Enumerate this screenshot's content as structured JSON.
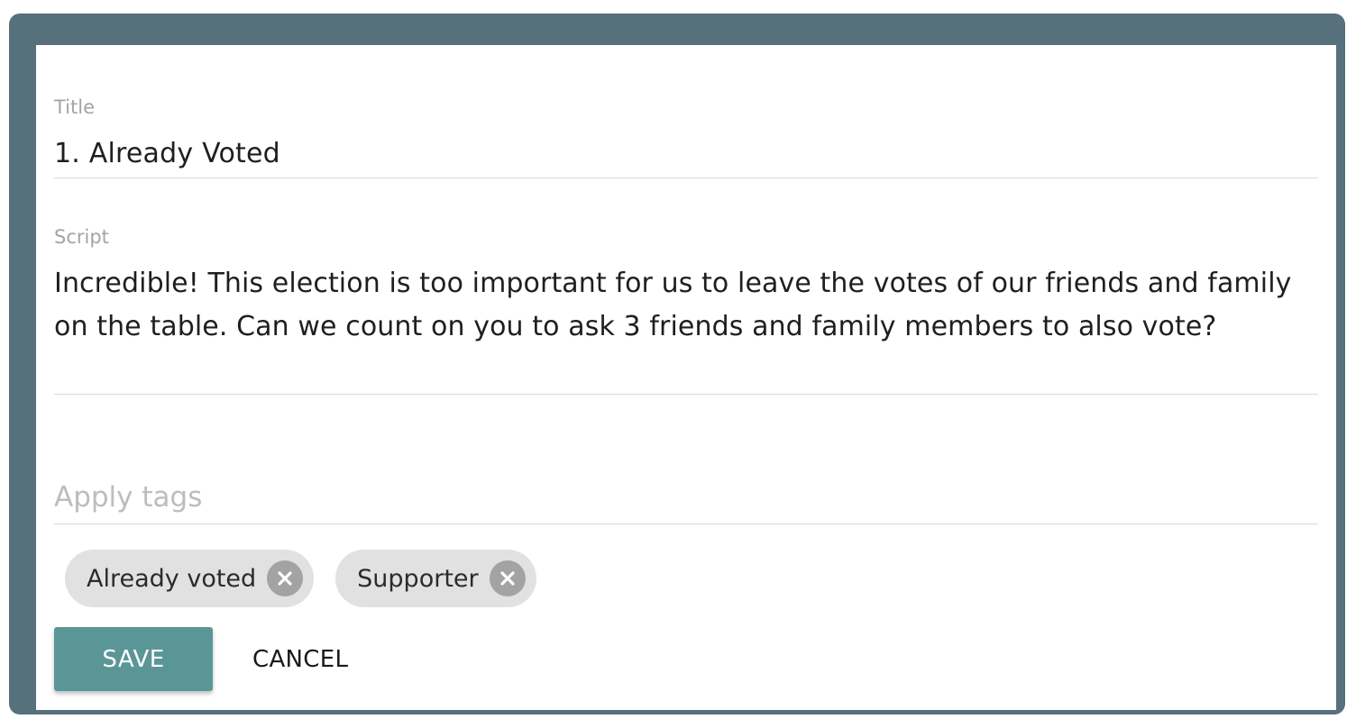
{
  "title_field": {
    "label": "Title",
    "value": "1. Already Voted"
  },
  "script_field": {
    "label": "Script",
    "value": "Incredible! This election is too important for us to leave the votes of our friends and family on the table. Can we count on you to ask 3 friends and family members to also vote?"
  },
  "tags_field": {
    "placeholder": "Apply tags",
    "value": ""
  },
  "tags": [
    {
      "label": "Already voted",
      "remove_icon": "close-circle-icon"
    },
    {
      "label": "Supporter",
      "remove_icon": "close-circle-icon"
    }
  ],
  "actions": {
    "save_label": "SAVE",
    "cancel_label": "CANCEL"
  },
  "colors": {
    "frame": "#56707c",
    "save_button": "#5b9697",
    "chip_background": "#e1e1e1",
    "chip_remove": "#a3a3a3"
  }
}
